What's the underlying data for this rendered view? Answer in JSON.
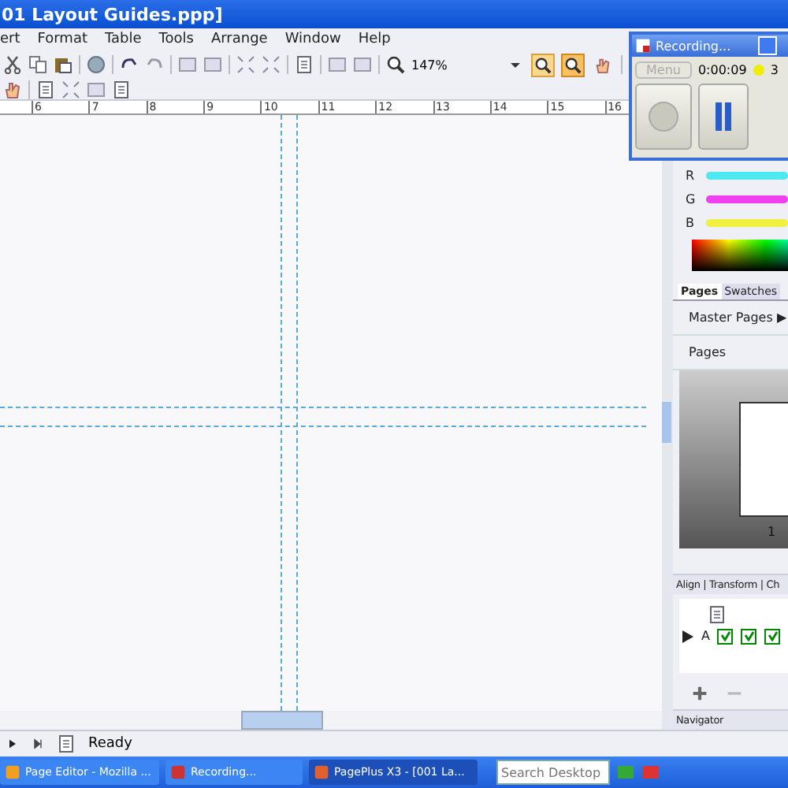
{
  "window": {
    "title": "01 Layout Guides.ppp]"
  },
  "menu": [
    "ert",
    "Format",
    "Table",
    "Tools",
    "Arrange",
    "Window",
    "Help"
  ],
  "toolbar": {
    "zoom_value": "147%",
    "tools": [
      {
        "kind": "zoom",
        "active": true
      },
      {
        "kind": "hand",
        "active": false
      }
    ]
  },
  "ruler": [
    "6",
    "7",
    "8",
    "9",
    "10",
    "11",
    "12",
    "13",
    "14",
    "15",
    "16"
  ],
  "recorder": {
    "title": "Recording...",
    "menu": "Menu",
    "time": "0:00:09",
    "count": "3"
  },
  "color_panel": {
    "channels": [
      "R",
      "G",
      "B"
    ]
  },
  "pages_panel": {
    "tabs": [
      {
        "label": "Pages",
        "selected": true
      },
      {
        "label": "Swatches",
        "selected": false
      }
    ],
    "master_pages": "Master Pages ▶",
    "pages": "Pages",
    "page_number": "1"
  },
  "layers_panel": {
    "title": "Align | Transform | Ch",
    "layers": [
      {
        "name": "A",
        "current": true,
        "flags": [
          {
            "checked": true
          },
          {
            "checked": true
          },
          {
            "checked": true
          }
        ]
      }
    ]
  },
  "navigator": {
    "title": "Navigator"
  },
  "status_bar": {
    "text": "Ready"
  },
  "taskbar": {
    "buttons": [
      {
        "label": "Page Editor - Mozilla ...",
        "selected": false
      },
      {
        "label": "Recording...",
        "selected": false
      },
      {
        "label": "PagePlus X3 - [001 La...",
        "selected": true
      }
    ],
    "search": {
      "placeholder": "Search Desktop"
    }
  }
}
